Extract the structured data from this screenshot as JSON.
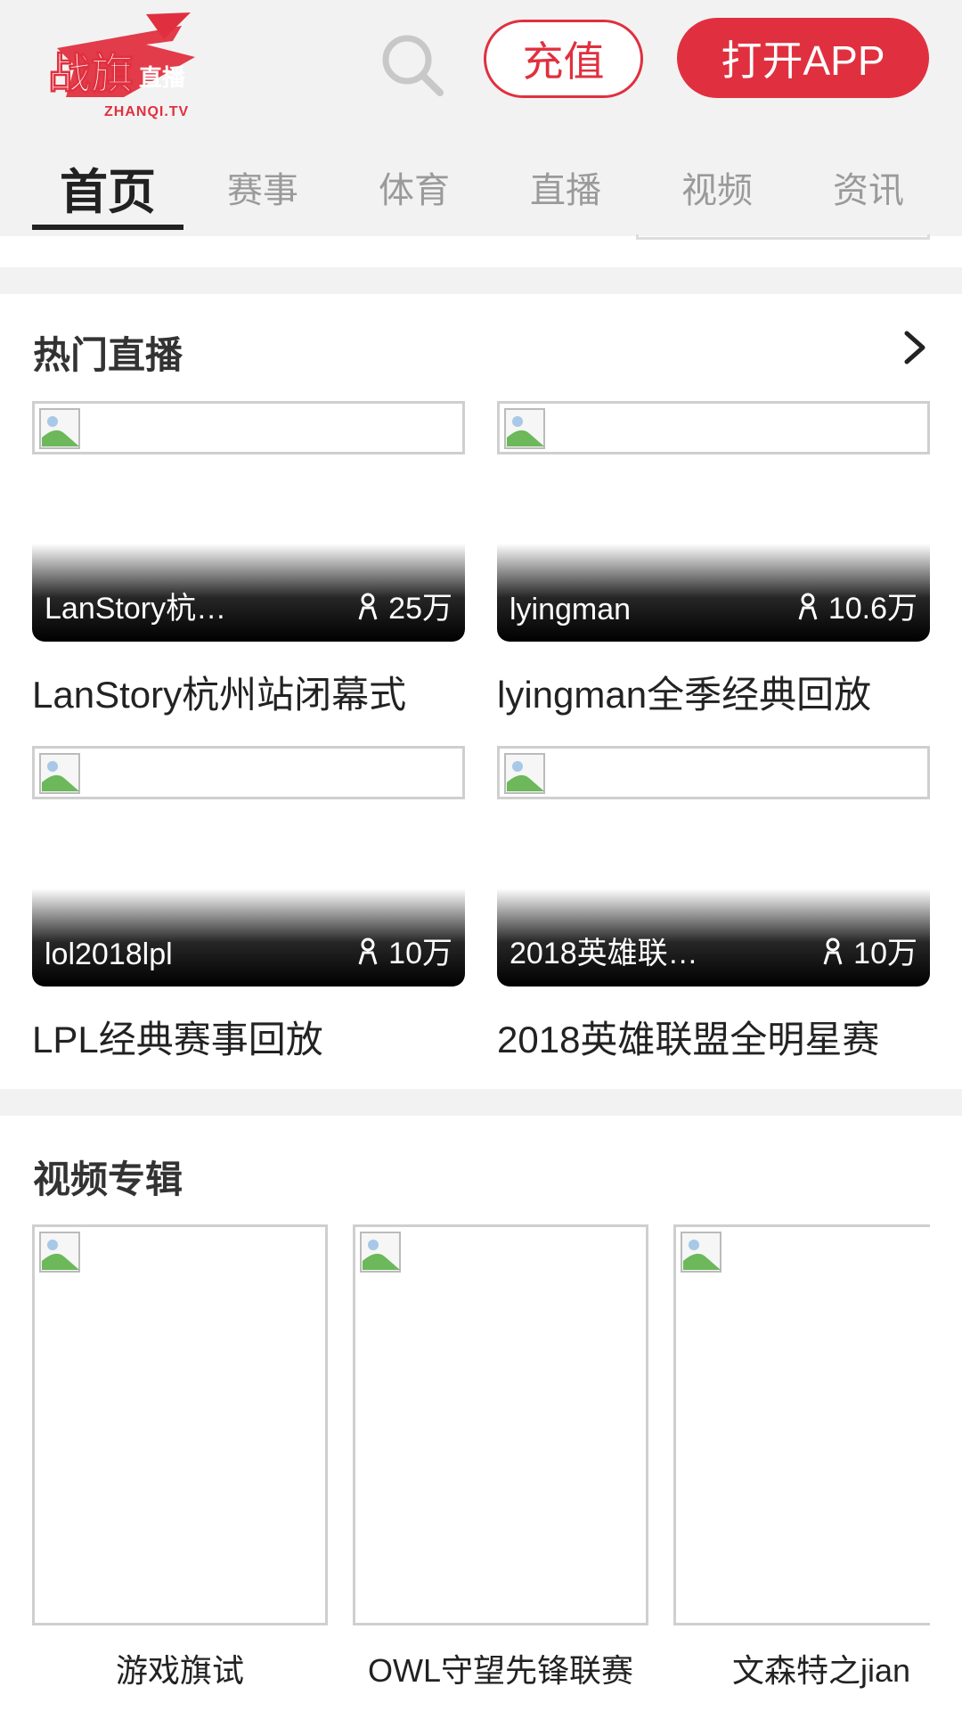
{
  "header": {
    "logo_main": "战旗直播",
    "logo_sub": "ZHANQI.TV",
    "recharge_label": "充值",
    "open_app_label": "打开APP"
  },
  "tabs": [
    {
      "label": "首页",
      "active": true
    },
    {
      "label": "赛事"
    },
    {
      "label": "体育"
    },
    {
      "label": "直播"
    },
    {
      "label": "视频"
    },
    {
      "label": "资讯"
    }
  ],
  "hot_live": {
    "title": "热门直播",
    "items": [
      {
        "streamer": "LanStory杭…",
        "viewers": "25万",
        "title": "LanStory杭州站闭幕式"
      },
      {
        "streamer": "lyingman",
        "viewers": "10.6万",
        "title": "lyingman全季经典回放"
      },
      {
        "streamer": "lol2018lpl",
        "viewers": "10万",
        "title": "LPL经典赛事回放"
      },
      {
        "streamer": "2018英雄联…",
        "viewers": "10万",
        "title": "2018英雄联盟全明星赛"
      }
    ]
  },
  "video_albums": {
    "title": "视频专辑",
    "items": [
      {
        "label": "游戏旗试"
      },
      {
        "label": "OWL守望先锋联赛"
      },
      {
        "label": "文森特之jian"
      }
    ]
  },
  "colors": {
    "accent": "#e0303f",
    "header_bg": "#f2f2f2",
    "text": "#222222",
    "tab_inactive": "#9a9a9a"
  },
  "icons": {
    "search": "search-icon",
    "chevron": "chevron-right-icon",
    "viewers": "person-icon",
    "broken_image": "broken-image-icon"
  }
}
